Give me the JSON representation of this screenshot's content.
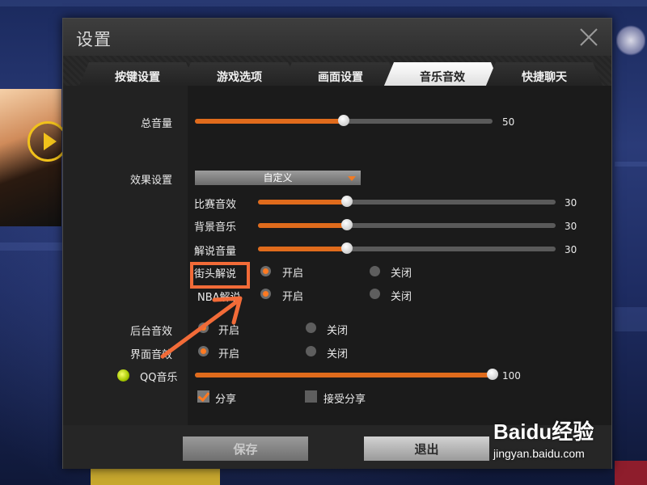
{
  "dialog": {
    "title": "设置"
  },
  "tabs": [
    {
      "label": "按键设置",
      "active": false
    },
    {
      "label": "游戏选项",
      "active": false
    },
    {
      "label": "画面设置",
      "active": false
    },
    {
      "label": "音乐音效",
      "active": true
    },
    {
      "label": "快捷聊天",
      "active": false
    }
  ],
  "settings": {
    "master_volume": {
      "label": "总音量",
      "value": "50",
      "fraction": 0.5
    },
    "effect_setting": {
      "label": "效果设置",
      "selected": "自定义"
    },
    "match_sfx": {
      "label": "比赛音效",
      "value": "30",
      "fraction": 0.3
    },
    "bgm": {
      "label": "背景音乐",
      "value": "30",
      "fraction": 0.3
    },
    "commentary_volume": {
      "label": "解说音量",
      "value": "30",
      "fraction": 0.3
    },
    "street_commentary": {
      "label": "街头解说",
      "on_label": "开启",
      "off_label": "关闭",
      "selected": "on"
    },
    "nba_commentary": {
      "label": "NBA解说",
      "on_label": "开启",
      "off_label": "关闭",
      "selected": "on"
    },
    "background_sfx": {
      "label": "后台音效",
      "on_label": "开启",
      "off_label": "关闭",
      "selected": "on"
    },
    "ui_sfx": {
      "label": "界面音效",
      "on_label": "开启",
      "off_label": "关闭",
      "selected": "on"
    },
    "qq_music": {
      "label": "QQ音乐",
      "value": "100",
      "fraction": 1.0
    },
    "share": {
      "label": "分享",
      "checked": true
    },
    "accept_share": {
      "label": "接受分享",
      "checked": false
    }
  },
  "footer": {
    "save_label": "保存",
    "exit_label": "退出"
  },
  "colors": {
    "accent": "#e06b1c",
    "highlight": "#f26b38",
    "active_tab": "#f0f0f0",
    "dialog_bg": "#232323"
  },
  "icons": {
    "close": "close-icon",
    "qq_music": "qq-music-icon",
    "dropdown_caret": "caret-down-icon"
  },
  "watermark": {
    "brand": "Baidu经验",
    "url": "jingyan.baidu.com"
  }
}
